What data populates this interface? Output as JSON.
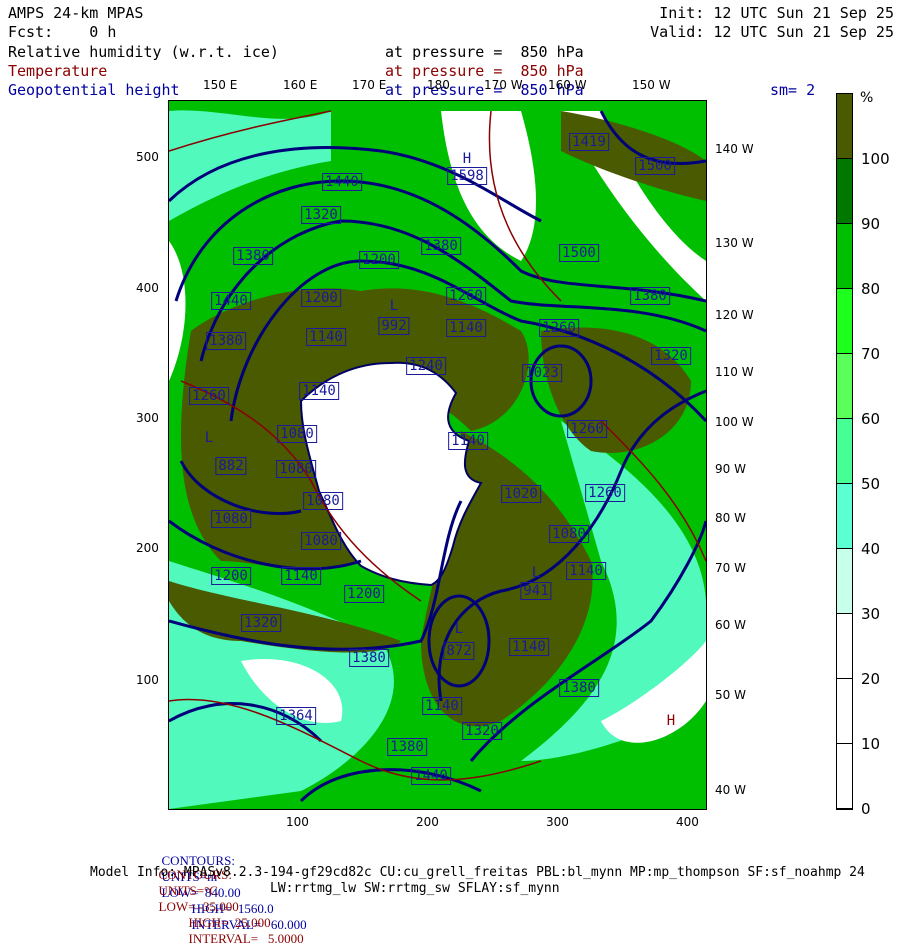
{
  "header": {
    "model": "AMPS 24-km MPAS",
    "fcst": "Fcst:    0 h",
    "init": "Init: 12 UTC Sun 21 Sep 25",
    "valid": "Valid: 12 UTC Sun 21 Sep 25",
    "fields": [
      {
        "name": "Relative humidity (w.r.t. ice)",
        "level": "at pressure =  850 hPa"
      },
      {
        "name": "Temperature",
        "level": "at pressure =  850 hPa"
      },
      {
        "name": "Geopotential height",
        "level": "at pressure =  850 hPa"
      }
    ],
    "smoothing": "sm= 2"
  },
  "axes": {
    "top": [
      "150 E",
      "160 E",
      "170 E",
      "180",
      "170 W",
      "160 W",
      "150 W"
    ],
    "left": [
      "500",
      "400",
      "300",
      "200",
      "100"
    ],
    "bottom": [
      "100",
      "200",
      "300",
      "400"
    ],
    "right": [
      "140 W",
      "130 W",
      "120 W",
      "110 W",
      "100 W",
      "90 W",
      "80 W",
      "70 W",
      "60 W",
      "50 W",
      "40 W"
    ]
  },
  "colorbar": {
    "unit": "%",
    "labels": [
      "100",
      "90",
      "80",
      "70",
      "60",
      "50",
      "40",
      "30",
      "20",
      "10",
      "0"
    ],
    "colors": [
      "#4a5a00",
      "#007800",
      "#00bf00",
      "#1eff1e",
      "#5aff5a",
      "#46ff96",
      "#5affd2",
      "#c8ffeb",
      "#ffffff",
      "#ffffff",
      "#ffffff"
    ]
  },
  "contour_labels": [
    "1440",
    "1598",
    "1419",
    "1500",
    "1320",
    "1380",
    "1380",
    "1200",
    "1500",
    "1260",
    "1200",
    "1440",
    "1380",
    "1140",
    "992",
    "1140",
    "1260",
    "1380",
    "1320",
    "1023",
    "1240",
    "1140",
    "1260",
    "1080",
    "1140",
    "1260",
    "882",
    "1080",
    "1080",
    "1080",
    "1080",
    "1020",
    "1260",
    "1080",
    "1200",
    "1140",
    "1200",
    "941",
    "1140",
    "1320",
    "1380",
    "872",
    "1140",
    "1140",
    "1380",
    "1364",
    "1320",
    "1380",
    "1440"
  ],
  "extrema_labels": [
    "H",
    "L",
    "L",
    "L",
    "L",
    "H"
  ],
  "footer": {
    "height_contours": {
      "label": "CONTOURS:",
      "units": "UNITS=m",
      "low": "LOW=  840.00",
      "high": "HIGH=  1560.0",
      "interval": "INTERVAL=   60.000"
    },
    "temp_contours": {
      "label": "CONTOURS:",
      "units": "UNITS=°C",
      "low": "LOW= -35.000",
      "high": "HIGH=  25.000",
      "interval": "INTERVAL=   5.0000"
    },
    "model_info": "Model Info: MPASv8.2.3-194-gf29cd82c CU:cu_grell_freitas PBL:bl_mynn MP:mp_thompson SF:sf_noahmp 24",
    "model_info2": "LW:rrtmg_lw SW:rrtmg_sw SFLAY:sf_mynn"
  }
}
